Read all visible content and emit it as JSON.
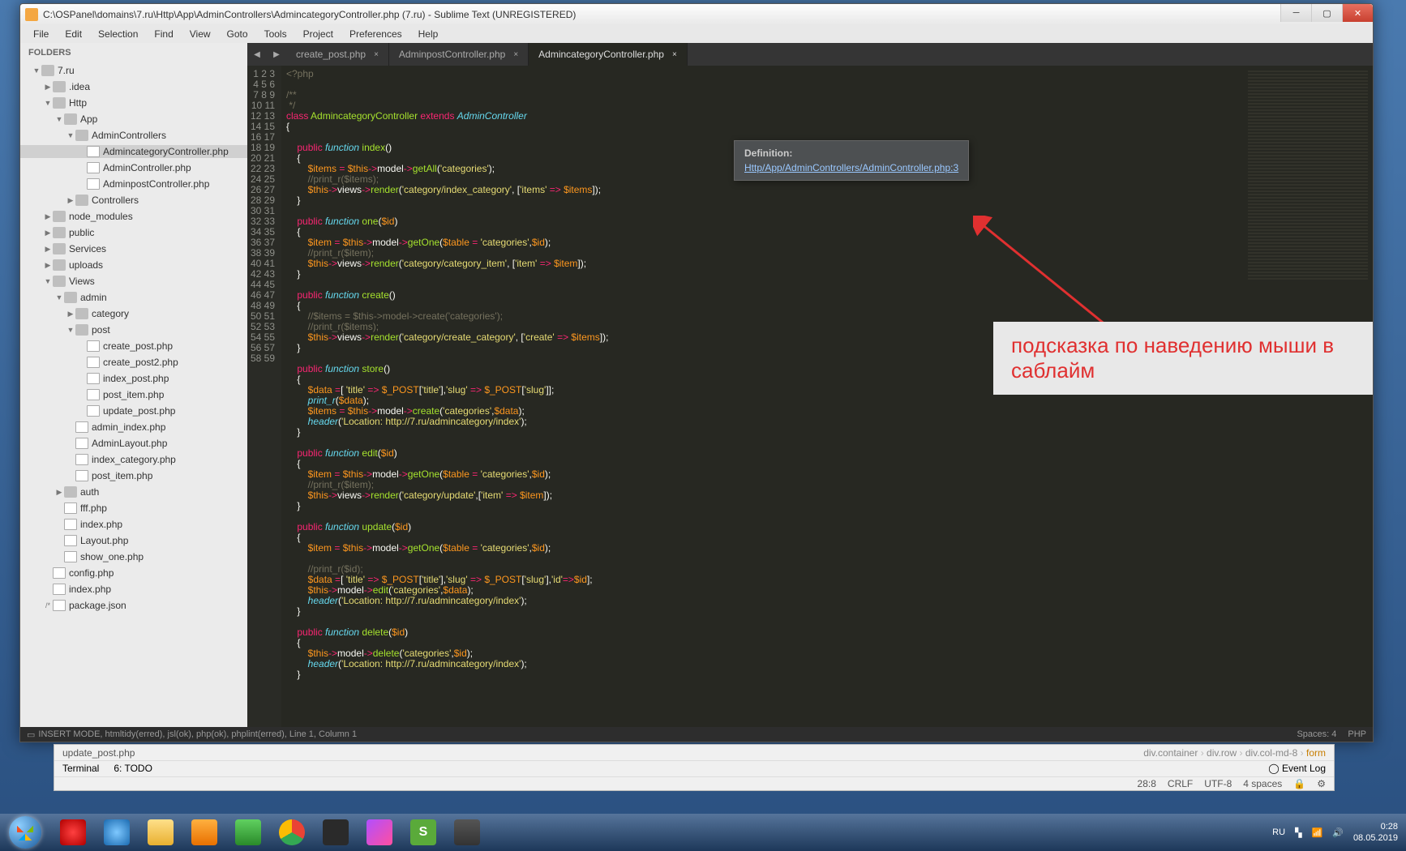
{
  "title": "C:\\OSPanel\\domains\\7.ru\\Http\\App\\AdminControllers\\AdmincategoryController.php (7.ru) - Sublime Text (UNREGISTERED)",
  "menu": [
    "File",
    "Edit",
    "Selection",
    "Find",
    "View",
    "Goto",
    "Tools",
    "Project",
    "Preferences",
    "Help"
  ],
  "sidebar_header": "FOLDERS",
  "tree": [
    {
      "d": 1,
      "t": "folder",
      "open": true,
      "n": "7.ru"
    },
    {
      "d": 2,
      "t": "folder",
      "open": false,
      "n": ".idea"
    },
    {
      "d": 2,
      "t": "folder",
      "open": true,
      "n": "Http"
    },
    {
      "d": 3,
      "t": "folder",
      "open": true,
      "n": "App"
    },
    {
      "d": 4,
      "t": "folder",
      "open": true,
      "n": "AdminControllers"
    },
    {
      "d": 5,
      "t": "file",
      "n": "AdmincategoryController.php",
      "sel": true
    },
    {
      "d": 5,
      "t": "file",
      "n": "AdminController.php"
    },
    {
      "d": 5,
      "t": "file",
      "n": "AdminpostController.php"
    },
    {
      "d": 4,
      "t": "folder",
      "open": false,
      "n": "Controllers"
    },
    {
      "d": 2,
      "t": "folder",
      "open": false,
      "n": "node_modules"
    },
    {
      "d": 2,
      "t": "folder",
      "open": false,
      "n": "public"
    },
    {
      "d": 2,
      "t": "folder",
      "open": false,
      "n": "Services"
    },
    {
      "d": 2,
      "t": "folder",
      "open": false,
      "n": "uploads"
    },
    {
      "d": 2,
      "t": "folder",
      "open": true,
      "n": "Views"
    },
    {
      "d": 3,
      "t": "folder",
      "open": true,
      "n": "admin"
    },
    {
      "d": 4,
      "t": "folder",
      "open": false,
      "n": "category"
    },
    {
      "d": 4,
      "t": "folder",
      "open": true,
      "n": "post"
    },
    {
      "d": 5,
      "t": "file",
      "n": "create_post.php"
    },
    {
      "d": 5,
      "t": "file",
      "n": "create_post2.php"
    },
    {
      "d": 5,
      "t": "file",
      "n": "index_post.php"
    },
    {
      "d": 5,
      "t": "file",
      "n": "post_item.php"
    },
    {
      "d": 5,
      "t": "file",
      "n": "update_post.php"
    },
    {
      "d": 4,
      "t": "file",
      "n": "admin_index.php"
    },
    {
      "d": 4,
      "t": "file",
      "n": "AdminLayout.php"
    },
    {
      "d": 4,
      "t": "file",
      "n": "index_category.php"
    },
    {
      "d": 4,
      "t": "file",
      "n": "post_item.php"
    },
    {
      "d": 3,
      "t": "folder",
      "open": false,
      "n": "auth"
    },
    {
      "d": 3,
      "t": "file",
      "n": "fff.php"
    },
    {
      "d": 3,
      "t": "file",
      "n": "index.php"
    },
    {
      "d": 3,
      "t": "file",
      "n": "Layout.php"
    },
    {
      "d": 3,
      "t": "file",
      "n": "show_one.php"
    },
    {
      "d": 2,
      "t": "file",
      "n": "config.php"
    },
    {
      "d": 2,
      "t": "file",
      "n": "index.php"
    },
    {
      "d": 2,
      "t": "file",
      "n": "package.json",
      "pre": "/*"
    }
  ],
  "tabs": [
    {
      "label": "create_post.php",
      "active": false
    },
    {
      "label": "AdminpostController.php",
      "active": false
    },
    {
      "label": "AdmincategoryController.php",
      "active": true
    }
  ],
  "tooltip": {
    "title": "Definition:",
    "link": "Http/App/AdminControllers/AdminController.php:3"
  },
  "callout": "подсказка по наведению мыши в саблайм",
  "status_left_icon": "▭",
  "status_left": "INSERT MODE, htmltidy(erred), jsl(ok), php(ok), phplint(erred), Line 1, Column 1",
  "status_right": {
    "spaces": "Spaces: 4",
    "lang": "PHP"
  },
  "ide": {
    "tabfile": "update_post.php",
    "crumbs": [
      "div.container",
      "div.row",
      "div.col-md-8",
      "form"
    ],
    "tools": [
      "Terminal",
      "6: TODO"
    ],
    "eventlog": "Event Log",
    "pos": "28:8",
    "crlf": "CRLF",
    "enc": "UTF-8",
    "indent": "4 spaces"
  },
  "tray": {
    "lang": "RU",
    "time": "0:28",
    "date": "08.05.2019"
  },
  "code": [
    "<span class='cm'>&lt;?php</span>",
    "",
    "<span class='cm'>/**</span>",
    "<span class='cm'> */</span>",
    "<span class='kw'>class</span> <span class='cl'>AdmincategoryController</span> <span class='kw'>extends</span> <span class='fn'>AdminController</span>",
    "{",
    "",
    "    <span class='kw'>public</span> <span class='fn'>function</span> <span class='nm'>index</span>()",
    "    {",
    "        <span class='va'>$items</span> <span class='op'>=</span> <span class='va'>$this</span><span class='op'>-&gt;</span>model<span class='op'>-&gt;</span><span class='nm'>getAll</span>(<span class='st'>'categories'</span>);",
    "        <span class='cm'>//print_r($items);</span>",
    "        <span class='va'>$this</span><span class='op'>-&gt;</span>views<span class='op'>-&gt;</span><span class='nm'>render</span>(<span class='st'>'category/index_category'</span>, [<span class='st'>'items'</span> <span class='op'>=&gt;</span> <span class='va'>$items</span>]);",
    "    }",
    "",
    "    <span class='kw'>public</span> <span class='fn'>function</span> <span class='nm'>one</span>(<span class='va'>$id</span>)",
    "    {",
    "        <span class='va'>$item</span> <span class='op'>=</span> <span class='va'>$this</span><span class='op'>-&gt;</span>model<span class='op'>-&gt;</span><span class='nm'>getOne</span>(<span class='va'>$table</span> <span class='op'>=</span> <span class='st'>'categories'</span>,<span class='va'>$id</span>);",
    "        <span class='cm'>//print_r($item);</span>",
    "        <span class='va'>$this</span><span class='op'>-&gt;</span>views<span class='op'>-&gt;</span><span class='nm'>render</span>(<span class='st'>'category/category_item'</span>, [<span class='st'>'item'</span> <span class='op'>=&gt;</span> <span class='va'>$item</span>]);",
    "    }",
    "",
    "    <span class='kw'>public</span> <span class='fn'>function</span> <span class='nm'>create</span>()",
    "    {",
    "        <span class='cm'>//$items = $this-&gt;model-&gt;create('categories');</span>",
    "        <span class='cm'>//print_r($items);</span>",
    "        <span class='va'>$this</span><span class='op'>-&gt;</span>views<span class='op'>-&gt;</span><span class='nm'>render</span>(<span class='st'>'category/create_category'</span>, [<span class='st'>'create'</span> <span class='op'>=&gt;</span> <span class='va'>$items</span>]);",
    "    }",
    "",
    "    <span class='kw'>public</span> <span class='fn'>function</span> <span class='nm'>store</span>()",
    "    {",
    "        <span class='va'>$data</span> <span class='op'>=</span>[ <span class='st'>'title'</span> <span class='op'>=&gt;</span> <span class='va'>$_POST</span>[<span class='st'>'title'</span>],<span class='st'>'slug'</span> <span class='op'>=&gt;</span> <span class='va'>$_POST</span>[<span class='st'>'slug'</span>]];",
    "        <span class='fn'>print_r</span>(<span class='va'>$data</span>);",
    "        <span class='va'>$items</span> <span class='op'>=</span> <span class='va'>$this</span><span class='op'>-&gt;</span>model<span class='op'>-&gt;</span><span class='nm'>create</span>(<span class='st'>'categories'</span>,<span class='va'>$data</span>);",
    "        <span class='fn'>header</span>(<span class='st'>'Location: http://7.ru/admincategory/index'</span>);",
    "    }",
    "",
    "    <span class='kw'>public</span> <span class='fn'>function</span> <span class='nm'>edit</span>(<span class='va'>$id</span>)",
    "    {",
    "        <span class='va'>$item</span> <span class='op'>=</span> <span class='va'>$this</span><span class='op'>-&gt;</span>model<span class='op'>-&gt;</span><span class='nm'>getOne</span>(<span class='va'>$table</span> <span class='op'>=</span> <span class='st'>'categories'</span>,<span class='va'>$id</span>);",
    "        <span class='cm'>//print_r($item);</span>",
    "        <span class='va'>$this</span><span class='op'>-&gt;</span>views<span class='op'>-&gt;</span><span class='nm'>render</span>(<span class='st'>'category/update'</span>,[<span class='st'>'item'</span> <span class='op'>=&gt;</span> <span class='va'>$item</span>]);",
    "    }",
    "",
    "    <span class='kw'>public</span> <span class='fn'>function</span> <span class='nm'>update</span>(<span class='va'>$id</span>)",
    "    {",
    "        <span class='va'>$item</span> <span class='op'>=</span> <span class='va'>$this</span><span class='op'>-&gt;</span>model<span class='op'>-&gt;</span><span class='nm'>getOne</span>(<span class='va'>$table</span> <span class='op'>=</span> <span class='st'>'categories'</span>,<span class='va'>$id</span>);",
    "",
    "        <span class='cm'>//print_r($id);</span>",
    "        <span class='va'>$data</span> <span class='op'>=</span>[ <span class='st'>'title'</span> <span class='op'>=&gt;</span> <span class='va'>$_POST</span>[<span class='st'>'title'</span>],<span class='st'>'slug'</span> <span class='op'>=&gt;</span> <span class='va'>$_POST</span>[<span class='st'>'slug'</span>],<span class='st'>'id'</span><span class='op'>=&gt;</span><span class='va'>$id</span>];",
    "        <span class='va'>$this</span><span class='op'>-&gt;</span>model<span class='op'>-&gt;</span><span class='nm'>edit</span>(<span class='st'>'categories'</span>,<span class='va'>$data</span>);",
    "        <span class='fn'>header</span>(<span class='st'>'Location: http://7.ru/admincategory/index'</span>);",
    "    }",
    "",
    "    <span class='kw'>public</span> <span class='fn'>function</span> <span class='nm'>delete</span>(<span class='va'>$id</span>)",
    "    {",
    "        <span class='va'>$this</span><span class='op'>-&gt;</span>model<span class='op'>-&gt;</span><span class='nm'>delete</span>(<span class='st'>'categories'</span>,<span class='va'>$id</span>);",
    "        <span class='fn'>header</span>(<span class='st'>'Location: http://7.ru/admincategory/index'</span>);",
    "    }",
    ""
  ]
}
